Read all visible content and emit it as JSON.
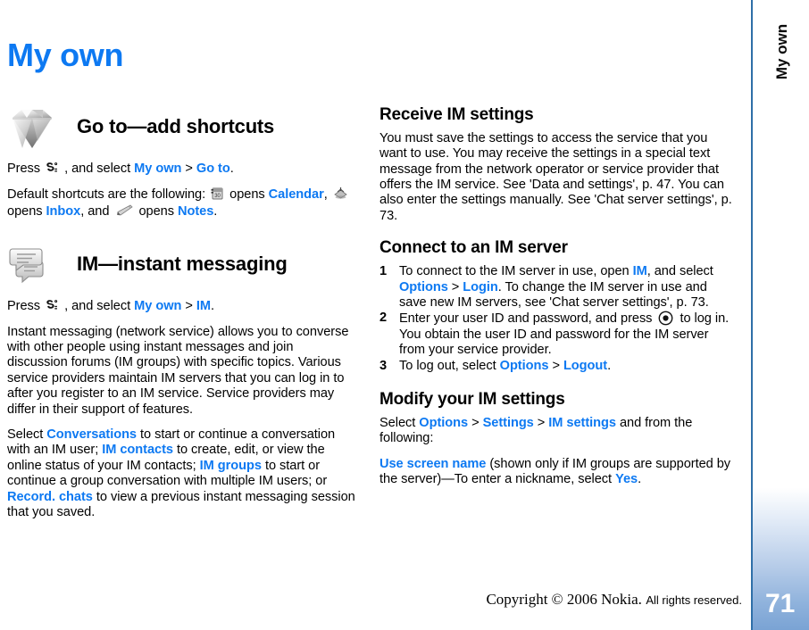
{
  "document": {
    "title": "My own",
    "page_number": "71",
    "sidebar_tab": "My own",
    "title_color": "#0d79f2",
    "accent_color": "#0d79f2"
  },
  "footer": {
    "copyright_serif": "Copyright © 2006 Nokia.",
    "copyright_sans": "All rights reserved."
  },
  "left_column": {
    "goto": {
      "heading": "Go to—add shortcuts",
      "icon": "diamond-gem-icon",
      "p1": {
        "a": "Press",
        "b": ", and select",
        "c": "My own",
        "sep": ">",
        "d": "Go to",
        "e": "."
      },
      "p2": {
        "a": "Default shortcuts are the following:",
        "b": "opens",
        "c": "Calendar",
        "d": ",",
        "e": "opens",
        "f": "Inbox",
        "g": ", and",
        "h": "opens",
        "i": "Notes",
        "j": "."
      }
    },
    "im": {
      "heading": "IM—instant messaging",
      "icon": "speech-bubbles-icon",
      "p1": {
        "a": "Press",
        "b": ", and select",
        "c": "My own",
        "sep": ">",
        "d": "IM",
        "e": "."
      },
      "p2": "Instant messaging (network service) allows you to converse with other people using instant messages and join discussion forums (IM groups) with specific topics. Various service providers maintain IM servers that you can log in to after you register to an IM service. Service providers may differ in their support of features.",
      "p3": {
        "a": "Select",
        "b": "Conversations",
        "c": "to start or continue a conversation with an IM user;",
        "d": "IM contacts",
        "e": "to create, edit, or view the online status of your IM contacts;",
        "f": "IM groups",
        "g": "to start or continue a group conversation with multiple IM users; or",
        "h": "Record. chats",
        "i": "to view a previous instant messaging session that you saved."
      }
    }
  },
  "right_column": {
    "receive": {
      "heading": "Receive IM settings",
      "body": "You must save the settings to access the service that you want to use. You may receive the settings in a special text message from the network operator or service provider that offers the IM service. See 'Data and settings', p. 47. You can also enter the settings manually. See 'Chat server settings', p. 73."
    },
    "connect": {
      "heading": "Connect to an IM server",
      "steps": [
        {
          "num": "1",
          "a": "To connect to the IM server in use, open",
          "b": "IM",
          "c": ", and select",
          "d": "Options",
          "sep": ">",
          "e": "Login",
          "f": ". To change the IM server in use and save new IM servers, see 'Chat server settings', p. 73."
        },
        {
          "num": "2",
          "a": "Enter your user ID and password, and press",
          "b": "to log in. You obtain the user ID and password for the IM server from your service provider.",
          "icon": "scroll-select-key-icon"
        },
        {
          "num": "3",
          "a": "To log out, select",
          "b": "Options",
          "sep": ">",
          "c": "Logout",
          "d": "."
        }
      ]
    },
    "modify": {
      "heading": "Modify your IM settings",
      "p1": {
        "a": "Select",
        "b": "Options",
        "sep1": ">",
        "c": "Settings",
        "sep2": ">",
        "d": "IM settings",
        "e": "and from the following:"
      },
      "p2": {
        "a": "Use screen name",
        "b": "(shown only if IM groups are supported by the server)—To enter a nickname, select",
        "c": "Yes",
        "d": "."
      }
    }
  }
}
